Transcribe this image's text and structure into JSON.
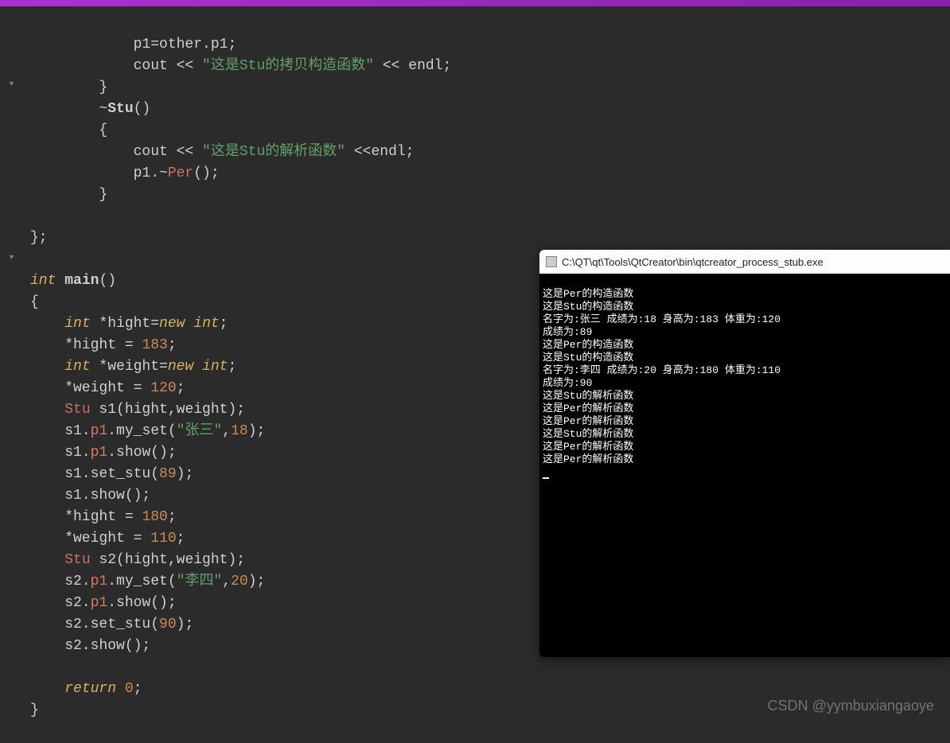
{
  "code": {
    "l1": "            p1=other.p1;",
    "l2a": "            cout << ",
    "l2b": "\"这是Stu的拷贝构造函数\"",
    "l2c": " << endl;",
    "l3": "        }",
    "l4a": "        ~",
    "l4b": "Stu",
    "l4c": "()",
    "l5": "        {",
    "l6a": "            cout << ",
    "l6b": "\"这是Stu的解析函数\"",
    "l6c": " <<endl;",
    "l7a": "            p1.~",
    "l7b": "Per",
    "l7c": "();",
    "l8": "        }",
    "l9": "",
    "l10": "};",
    "l11": "",
    "l12a": "int",
    "l12b": " ",
    "l12c": "main",
    "l12d": "()",
    "l13": "{",
    "l14a": "    ",
    "l14b": "int",
    "l14c": " *hight=",
    "l14d": "new",
    "l14e": " ",
    "l14f": "int",
    "l14g": ";",
    "l15a": "    *hight = ",
    "l15b": "183",
    "l15c": ";",
    "l16a": "    ",
    "l16b": "int",
    "l16c": " *weight=",
    "l16d": "new",
    "l16e": " ",
    "l16f": "int",
    "l16g": ";",
    "l17a": "    *weight = ",
    "l17b": "120",
    "l17c": ";",
    "l18a": "    ",
    "l18b": "Stu",
    "l18c": " s1(hight,weight);",
    "l19a": "    s1.",
    "l19b": "p1",
    "l19c": ".my_set(",
    "l19d": "\"张三\"",
    "l19e": ",",
    "l19f": "18",
    "l19g": ");",
    "l20a": "    s1.",
    "l20b": "p1",
    "l20c": ".show();",
    "l21a": "    s1.set_stu(",
    "l21b": "89",
    "l21c": ");",
    "l22": "    s1.show();",
    "l23a": "    *hight = ",
    "l23b": "180",
    "l23c": ";",
    "l24a": "    *weight = ",
    "l24b": "110",
    "l24c": ";",
    "l25a": "    ",
    "l25b": "Stu",
    "l25c": " s2(hight,weight);",
    "l26a": "    s2.",
    "l26b": "p1",
    "l26c": ".my_set(",
    "l26d": "\"李四\"",
    "l26e": ",",
    "l26f": "20",
    "l26g": ");",
    "l27a": "    s2.",
    "l27b": "p1",
    "l27c": ".show();",
    "l28a": "    s2.set_stu(",
    "l28b": "90",
    "l28c": ");",
    "l29": "    s2.show();",
    "l30": "",
    "l31a": "    ",
    "l31b": "return",
    "l31c": " ",
    "l31d": "0",
    "l31e": ";",
    "l32": "}"
  },
  "console": {
    "title": "C:\\QT\\qt\\Tools\\QtCreator\\bin\\qtcreator_process_stub.exe",
    "lines": [
      "这是Per的构造函数",
      "这是Stu的构造函数",
      "名字为:张三 成绩为:18 身高为:183 体重为:120",
      "成绩为:89",
      "这是Per的构造函数",
      "这是Stu的构造函数",
      "名字为:李四 成绩为:20 身高为:180 体重为:110",
      "成绩为:90",
      "这是Stu的解析函数",
      "这是Per的解析函数",
      "这是Per的解析函数",
      "这是Stu的解析函数",
      "这是Per的解析函数",
      "这是Per的解析函数"
    ]
  },
  "watermark": "CSDN @yymbuxiangaoye"
}
